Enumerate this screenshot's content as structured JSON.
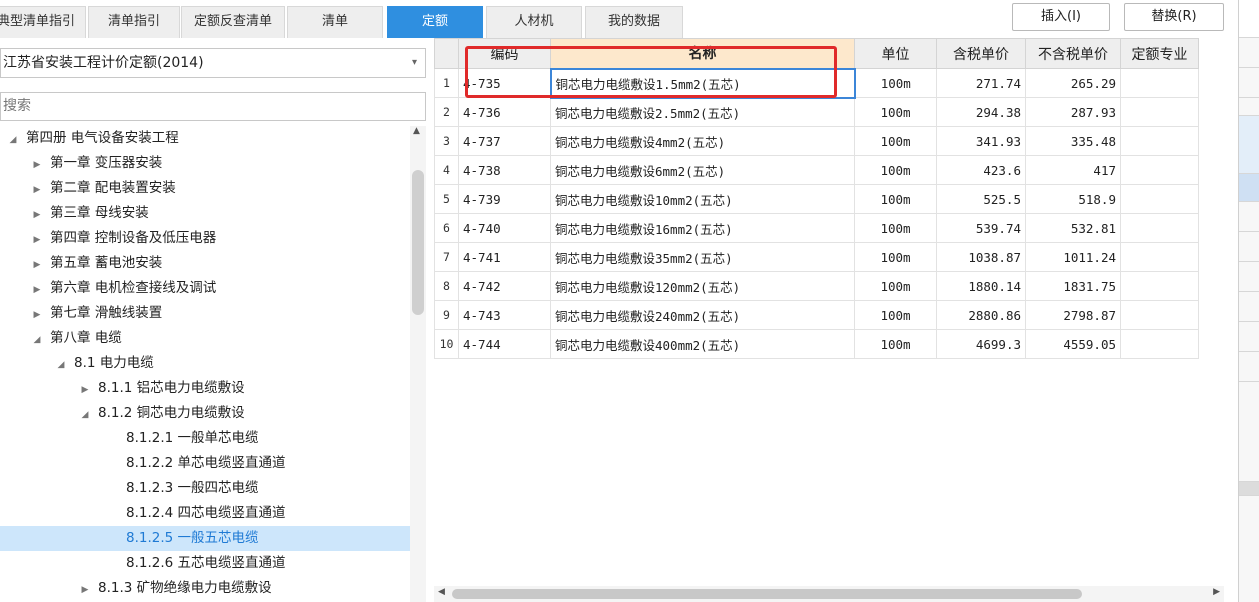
{
  "tabs": [
    {
      "label": "典型清单指引",
      "active": false
    },
    {
      "label": "清单指引",
      "active": false
    },
    {
      "label": "定额反查清单",
      "active": false
    },
    {
      "label": "清单",
      "active": false
    },
    {
      "label": "定额",
      "active": true
    },
    {
      "label": "人材机",
      "active": false
    },
    {
      "label": "我的数据",
      "active": false
    }
  ],
  "toolbar": {
    "insert_label": "插入(I)",
    "replace_label": "替换(R)"
  },
  "left": {
    "quota_library": "江苏省安装工程计价定额(2014)",
    "search_placeholder": "搜索"
  },
  "tree": [
    {
      "label": "第四册 电气设备安装工程",
      "toggle": "◢",
      "level": 0,
      "selected": false
    },
    {
      "label": "第一章 变压器安装",
      "toggle": "▶",
      "level": 1,
      "selected": false
    },
    {
      "label": "第二章 配电装置安装",
      "toggle": "▶",
      "level": 1,
      "selected": false
    },
    {
      "label": "第三章 母线安装",
      "toggle": "▶",
      "level": 1,
      "selected": false
    },
    {
      "label": "第四章 控制设备及低压电器",
      "toggle": "▶",
      "level": 1,
      "selected": false
    },
    {
      "label": "第五章 蓄电池安装",
      "toggle": "▶",
      "level": 1,
      "selected": false
    },
    {
      "label": "第六章 电机检查接线及调试",
      "toggle": "▶",
      "level": 1,
      "selected": false
    },
    {
      "label": "第七章 滑触线装置",
      "toggle": "▶",
      "level": 1,
      "selected": false
    },
    {
      "label": "第八章 电缆",
      "toggle": "◢",
      "level": 1,
      "selected": false
    },
    {
      "label": "8.1 电力电缆",
      "toggle": "◢",
      "level": 2,
      "selected": false
    },
    {
      "label": "8.1.1 铝芯电力电缆敷设",
      "toggle": "▶",
      "level": 3,
      "selected": false
    },
    {
      "label": "8.1.2 铜芯电力电缆敷设",
      "toggle": "◢",
      "level": 3,
      "selected": false
    },
    {
      "label": "8.1.2.1 一般单芯电缆",
      "toggle": "",
      "level": 4,
      "selected": false
    },
    {
      "label": "8.1.2.2 单芯电缆竖直通道",
      "toggle": "",
      "level": 4,
      "selected": false
    },
    {
      "label": "8.1.2.3 一般四芯电缆",
      "toggle": "",
      "level": 4,
      "selected": false
    },
    {
      "label": "8.1.2.4 四芯电缆竖直通道",
      "toggle": "",
      "level": 4,
      "selected": false
    },
    {
      "label": "8.1.2.5 一般五芯电缆",
      "toggle": "",
      "level": 4,
      "selected": true
    },
    {
      "label": "8.1.2.6 五芯电缆竖直通道",
      "toggle": "",
      "level": 4,
      "selected": false
    },
    {
      "label": "8.1.3 矿物绝缘电力电缆敷设",
      "toggle": "▶",
      "level": 3,
      "selected": false
    }
  ],
  "grid": {
    "headers": [
      "编码",
      "名称",
      "单位",
      "含税单价",
      "不含税单价",
      "定额专业"
    ],
    "rows": [
      {
        "no": "1",
        "code": "4-735",
        "name": "铜芯电力电缆敷设1.5mm2(五芯)",
        "unit": "100m",
        "price_tax": "271.74",
        "price_notax": "265.29",
        "spec": ""
      },
      {
        "no": "2",
        "code": "4-736",
        "name": "铜芯电力电缆敷设2.5mm2(五芯)",
        "unit": "100m",
        "price_tax": "294.38",
        "price_notax": "287.93",
        "spec": ""
      },
      {
        "no": "3",
        "code": "4-737",
        "name": "铜芯电力电缆敷设4mm2(五芯)",
        "unit": "100m",
        "price_tax": "341.93",
        "price_notax": "335.48",
        "spec": ""
      },
      {
        "no": "4",
        "code": "4-738",
        "name": "铜芯电力电缆敷设6mm2(五芯)",
        "unit": "100m",
        "price_tax": "423.6",
        "price_notax": "417",
        "spec": ""
      },
      {
        "no": "5",
        "code": "4-739",
        "name": "铜芯电力电缆敷设10mm2(五芯)",
        "unit": "100m",
        "price_tax": "525.5",
        "price_notax": "518.9",
        "spec": ""
      },
      {
        "no": "6",
        "code": "4-740",
        "name": "铜芯电力电缆敷设16mm2(五芯)",
        "unit": "100m",
        "price_tax": "539.74",
        "price_notax": "532.81",
        "spec": ""
      },
      {
        "no": "7",
        "code": "4-741",
        "name": "铜芯电力电缆敷设35mm2(五芯)",
        "unit": "100m",
        "price_tax": "1038.87",
        "price_notax": "1011.24",
        "spec": ""
      },
      {
        "no": "8",
        "code": "4-742",
        "name": "铜芯电力电缆敷设120mm2(五芯)",
        "unit": "100m",
        "price_tax": "1880.14",
        "price_notax": "1831.75",
        "spec": ""
      },
      {
        "no": "9",
        "code": "4-743",
        "name": "铜芯电力电缆敷设240mm2(五芯)",
        "unit": "100m",
        "price_tax": "2880.86",
        "price_notax": "2798.87",
        "spec": ""
      },
      {
        "no": "10",
        "code": "4-744",
        "name": "铜芯电力电缆敷设400mm2(五芯)",
        "unit": "100m",
        "price_tax": "4699.3",
        "price_notax": "4559.05",
        "spec": ""
      }
    ]
  },
  "colors": {
    "accent": "#2f8fe0",
    "selection": "#cde6fb",
    "highlight_box": "#e02a2a"
  },
  "icons": {
    "dropdown": "chevron-down-icon",
    "collapse": "triangle-down-icon",
    "expand": "triangle-right-icon"
  }
}
